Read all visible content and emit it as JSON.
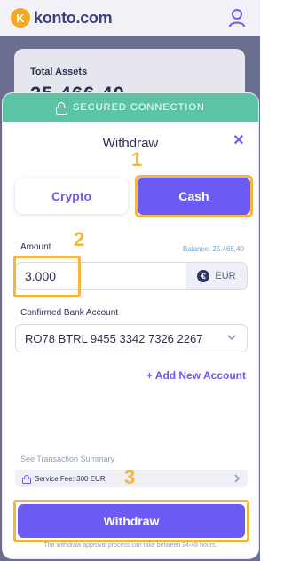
{
  "header": {
    "logo_letter": "K",
    "brand": "konto.com"
  },
  "background": {
    "assets_title": "Total Assets",
    "assets_value": "25.466,40"
  },
  "modal": {
    "secure_label": "SECURED CONNECTION",
    "title": "Withdraw",
    "close_glyph": "✕",
    "tabs": [
      {
        "label": "Crypto",
        "selected": false
      },
      {
        "label": "Cash",
        "selected": true
      }
    ],
    "amount": {
      "label": "Amount",
      "balance": "Balance: 25.466,40",
      "value": "3.000",
      "currency_symbol": "€",
      "currency": "EUR"
    },
    "bank": {
      "label": "Confirmed Bank Account",
      "selected": "RO78 BTRL 9455 3342 7326 2267"
    },
    "add_account": "+ Add New Account",
    "summary": {
      "link": "See Transaction Summary",
      "fee": "Service Fee: 300 EUR"
    },
    "withdraw_button": "Withdraw",
    "footnote": "The withdraw approval process can take between 24-48 hours."
  },
  "annotations": {
    "step1": "1",
    "step2": "2",
    "step3": "3"
  },
  "colors": {
    "accent": "#6b5bf2",
    "secure_bar": "#5dc3a5",
    "highlight": "#f4b63f",
    "logo": "#f4a91e"
  },
  "icons": [
    "logo-badge-icon",
    "user-icon",
    "lock-icon",
    "close-icon",
    "euro-icon",
    "chevron-down-icon",
    "chevron-right-icon"
  ]
}
